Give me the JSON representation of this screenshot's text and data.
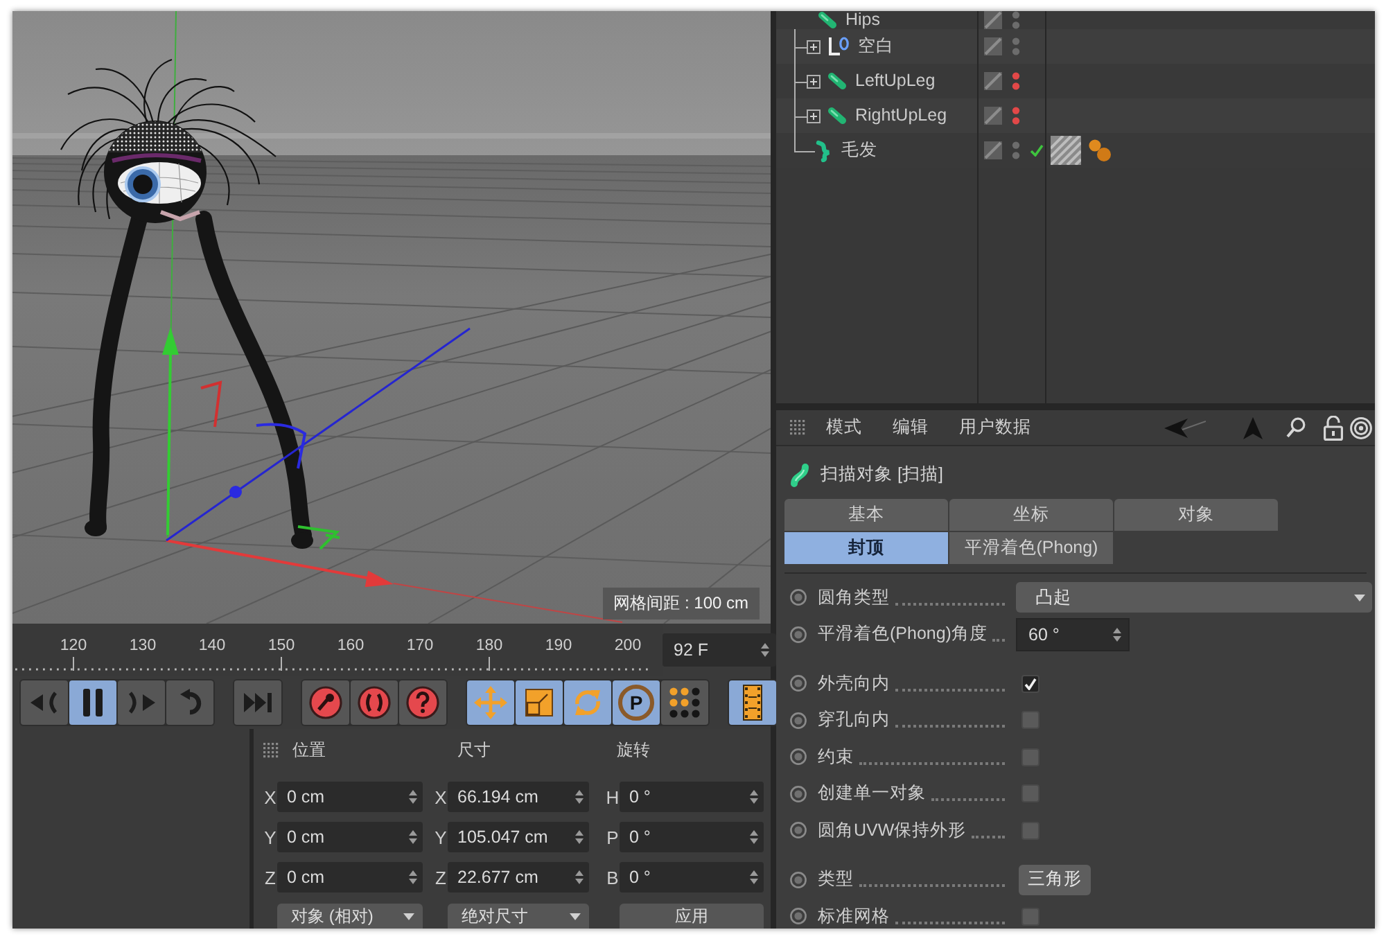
{
  "viewport": {
    "grid_spacing": "网格间距 : 100 cm"
  },
  "timeline": {
    "ticks": [
      "120",
      "130",
      "140",
      "150",
      "160",
      "170",
      "180",
      "190",
      "200"
    ],
    "current_frame": "92 F"
  },
  "transport_groups": [
    [
      {
        "kind": "prev-key",
        "selected": false
      },
      {
        "kind": "pause",
        "selected": true
      },
      {
        "kind": "next-key",
        "selected": false
      },
      {
        "kind": "loop",
        "selected": false
      }
    ],
    [
      {
        "kind": "goto-end",
        "selected": false
      }
    ],
    [
      {
        "kind": "record-key",
        "selected": false
      },
      {
        "kind": "autokey",
        "selected": false
      },
      {
        "kind": "key-help",
        "selected": false
      }
    ],
    [
      {
        "kind": "move",
        "selected": true
      },
      {
        "kind": "scale",
        "selected": true
      },
      {
        "kind": "rotate",
        "selected": true
      },
      {
        "kind": "param",
        "label": "P",
        "selected": true
      },
      {
        "kind": "point-level",
        "selected": false
      }
    ],
    [
      {
        "kind": "timeline",
        "selected": true
      }
    ]
  ],
  "coordinates": {
    "headers": [
      "位置",
      "尺寸",
      "旋转"
    ],
    "rows": [
      {
        "position_axis": "X",
        "position": "0 cm",
        "size_axis": "X",
        "size": "66.194 cm",
        "rotation_axis": "H",
        "rotation": "0 °"
      },
      {
        "position_axis": "Y",
        "position": "0 cm",
        "size_axis": "Y",
        "size": "105.047 cm",
        "rotation_axis": "P",
        "rotation": "0 °"
      },
      {
        "position_axis": "Z",
        "position": "0 cm",
        "size_axis": "Z",
        "size": "22.677 cm",
        "rotation_axis": "B",
        "rotation": "0 °"
      }
    ],
    "coordinate_mode": "对象 (相对)",
    "size_mode": "绝对尺寸",
    "apply": "应用"
  },
  "object_manager": {
    "objects": [
      {
        "name": "Hips",
        "kind": "joint",
        "hidden": false,
        "children": [
          {
            "name": "空白",
            "kind": "null",
            "expanded": false,
            "hidden": false
          },
          {
            "name": "LeftUpLeg",
            "kind": "joint",
            "expanded": false,
            "hidden": true
          },
          {
            "name": "RightUpLeg",
            "kind": "joint",
            "expanded": false,
            "hidden": true
          },
          {
            "name": "毛发",
            "kind": "hair",
            "hidden": false,
            "enabled": true,
            "tags": [
              {
                "kind": "hair-material"
              },
              {
                "kind": "hair"
              }
            ]
          }
        ]
      }
    ]
  },
  "attribute_manager": {
    "menu": [
      "模式",
      "编辑",
      "用户数据"
    ],
    "title": "扫描对象 [扫描]",
    "tab_rows": [
      [
        {
          "label": "基本",
          "selected": false
        },
        {
          "label": "坐标",
          "selected": false
        },
        {
          "label": "对象",
          "selected": false
        }
      ],
      [
        {
          "label": "封顶",
          "selected": true
        },
        {
          "label": "平滑着色(Phong)",
          "selected": false
        }
      ]
    ],
    "param_groups": [
      [
        {
          "kind": "dropdown",
          "label": "圆角类型",
          "value": "凸起"
        },
        {
          "kind": "spinner",
          "label": "平滑着色(Phong)角度",
          "value": "60 °"
        }
      ],
      [
        {
          "kind": "checkbox",
          "label": "外壳向内",
          "checked": true
        },
        {
          "kind": "checkbox",
          "label": "穿孔向内",
          "checked": false
        },
        {
          "kind": "checkbox",
          "label": "约束",
          "checked": false
        },
        {
          "kind": "checkbox",
          "label": "创建单一对象",
          "checked": false
        },
        {
          "kind": "checkbox",
          "label": "圆角UVW保持外形",
          "checked": false
        }
      ],
      [
        {
          "kind": "button",
          "label": "类型",
          "value": "三角形"
        },
        {
          "kind": "checkbox",
          "label": "标准网格",
          "checked": false
        }
      ]
    ]
  }
}
